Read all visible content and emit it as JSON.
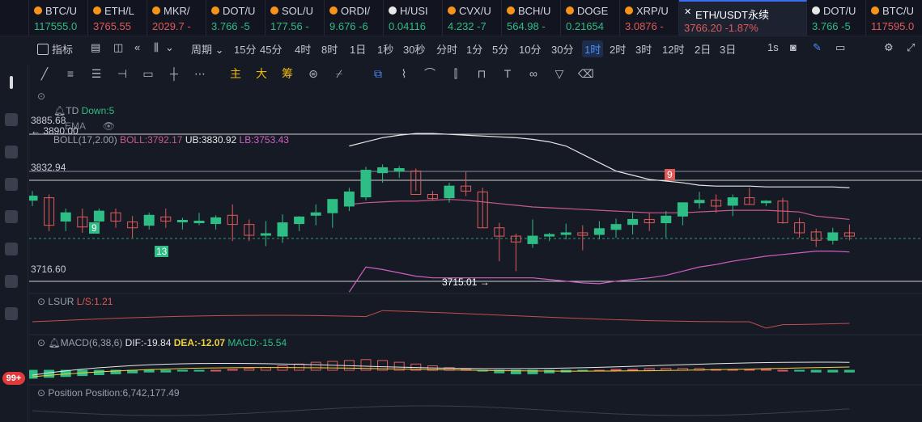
{
  "tickers": [
    {
      "name": "BTC/U",
      "price": "117555.0",
      "up": true,
      "icon": "btc-icon",
      "iconColor": "#f7931a"
    },
    {
      "name": "ETH/L",
      "price": "3765.55",
      "up": false,
      "icon": "eth-icon",
      "iconColor": "#f7931a"
    },
    {
      "name": "MKR/",
      "price": "2029.7 -",
      "up": false,
      "icon": "mkr-icon",
      "iconColor": "#f7931a"
    },
    {
      "name": "DOT/U",
      "price": "3.766 -5",
      "up": true,
      "icon": "dot-icon",
      "iconColor": "#f7931a"
    },
    {
      "name": "SOL/U",
      "price": "177.56 -",
      "up": true,
      "icon": "sol-icon",
      "iconColor": "#f7931a"
    },
    {
      "name": "ORDI/",
      "price": "9.676 -6",
      "up": true,
      "icon": "ordi-icon",
      "iconColor": "#f7931a"
    },
    {
      "name": "H/USI",
      "price": "0.04116",
      "up": true,
      "icon": "h-icon",
      "iconColor": "#e8e8e8"
    },
    {
      "name": "CVX/U",
      "price": "4.232 -7",
      "up": true,
      "icon": "cvx-icon",
      "iconColor": "#f7931a"
    },
    {
      "name": "BCH/U",
      "price": "564.98 -",
      "up": true,
      "icon": "bch-icon",
      "iconColor": "#f7931a"
    },
    {
      "name": "DOGE",
      "price": "0.21654",
      "up": true,
      "icon": "doge-icon",
      "iconColor": "#f7931a"
    },
    {
      "name": "XRP/U",
      "price": "3.0876 -",
      "up": false,
      "icon": "xrp-icon",
      "iconColor": "#f7931a"
    },
    {
      "name": "ETH/USDT永续",
      "price": "3766.20  -1.87%",
      "up": false,
      "active": true,
      "icon": "close-icon",
      "iconColor": "#ffffff"
    },
    {
      "name": "DOT/U",
      "price": "3.766 -5",
      "up": true,
      "icon": "dot-icon",
      "iconColor": "#e8e8e8"
    },
    {
      "name": "BTC/U",
      "price": "117595.0",
      "up": false,
      "icon": "btc-icon",
      "iconColor": "#f7931a"
    }
  ],
  "toolbar": {
    "indicator_label": "指标",
    "period_label": "周期",
    "intervals": [
      "15分",
      "45分",
      "4时",
      "8时",
      "1日",
      "1秒",
      "30秒",
      "分时",
      "1分",
      "5分",
      "10分",
      "30分",
      "1时",
      "2时",
      "3时",
      "12时",
      "2日",
      "3日"
    ],
    "active_interval": "1时",
    "right_label": "1s"
  },
  "drawtools": {
    "labels": [
      "主",
      "大",
      "筹"
    ]
  },
  "indicators": {
    "td": "TD",
    "td_value": "Down:5",
    "ema": "EMA",
    "boll": "BOLL(17,2.00)",
    "boll_mid": "BOLL:3792.17",
    "boll_ub": "UB:3830.92",
    "boll_lb": "LB:3753.43",
    "lsur": "LSUR",
    "lsur_value": "L/S:1.21",
    "macd": "MACD(6,38,6)",
    "macd_dif": "DIF:-19.84",
    "macd_dea": "DEA:-12.07",
    "macd_val": "MACD:-15.54",
    "position": "Position",
    "position_value": "Position:6,742,177.49"
  },
  "price_labels": {
    "top_price": "3885.68",
    "arrow_price": "← 3890.00",
    "level_2": "3832.94",
    "low_left": "3716.60",
    "low_mark": "3715.01 →"
  },
  "td_marks": [
    "9",
    "13",
    "9"
  ],
  "badge": "99+",
  "colors": {
    "up": "#2ebd85",
    "down": "#e05a5a",
    "boll_mid": "#c85a8a",
    "boll_band": "#d060c0",
    "accent": "#4a8ff7",
    "yellow": "#f0d040"
  },
  "chart_data": {
    "type": "candlestick",
    "ohlc": [
      [
        3815,
        3826,
        3808,
        3820
      ],
      [
        3818,
        3822,
        3778,
        3785
      ],
      [
        3790,
        3805,
        3778,
        3800
      ],
      [
        3795,
        3805,
        3776,
        3783
      ],
      [
        3790,
        3805,
        3783,
        3802
      ],
      [
        3800,
        3805,
        3782,
        3790
      ],
      [
        3789,
        3796,
        3770,
        3782
      ],
      [
        3785,
        3800,
        3780,
        3797
      ],
      [
        3795,
        3805,
        3782,
        3790
      ],
      [
        3789,
        3794,
        3780,
        3791
      ],
      [
        3788,
        3800,
        3785,
        3790
      ],
      [
        3787,
        3797,
        3780,
        3794
      ],
      [
        3797,
        3810,
        3766,
        3786
      ],
      [
        3786,
        3792,
        3766,
        3773
      ],
      [
        3773,
        3790,
        3760,
        3775
      ],
      [
        3772,
        3798,
        3764,
        3788
      ],
      [
        3787,
        3796,
        3778,
        3795
      ],
      [
        3797,
        3810,
        3785,
        3800
      ],
      [
        3800,
        3814,
        3782,
        3816
      ],
      [
        3808,
        3830,
        3802,
        3825
      ],
      [
        3819,
        3855,
        3815,
        3851
      ],
      [
        3848,
        3858,
        3836,
        3854
      ],
      [
        3850,
        3856,
        3842,
        3853
      ],
      [
        3850,
        3853,
        3826,
        3822
      ],
      [
        3822,
        3826,
        3815,
        3817
      ],
      [
        3818,
        3836,
        3812,
        3832
      ],
      [
        3832,
        3849,
        3820,
        3826
      ],
      [
        3825,
        3830,
        3782,
        3782
      ],
      [
        3782,
        3788,
        3742,
        3772
      ],
      [
        3772,
        3775,
        3730,
        3765
      ],
      [
        3763,
        3792,
        3758,
        3772
      ],
      [
        3772,
        3776,
        3766,
        3774
      ],
      [
        3774,
        3787,
        3768,
        3776
      ],
      [
        3776,
        3785,
        3755,
        3773
      ],
      [
        3774,
        3790,
        3768,
        3781
      ],
      [
        3780,
        3793,
        3770,
        3786
      ],
      [
        3786,
        3800,
        3774,
        3792
      ],
      [
        3792,
        3800,
        3778,
        3788
      ],
      [
        3788,
        3802,
        3770,
        3796
      ],
      [
        3796,
        3812,
        3785,
        3812
      ],
      [
        3812,
        3825,
        3805,
        3815
      ],
      [
        3815,
        3822,
        3800,
        3808
      ],
      [
        3809,
        3822,
        3796,
        3818
      ],
      [
        3818,
        3830,
        3810,
        3810
      ],
      [
        3812,
        3815,
        3808,
        3814
      ],
      [
        3814,
        3818,
        3787,
        3788
      ],
      [
        3788,
        3794,
        3770,
        3776
      ],
      [
        3777,
        3781,
        3759,
        3767
      ],
      [
        3767,
        3782,
        3762,
        3776
      ],
      [
        3776,
        3786,
        3767,
        3772
      ]
    ],
    "boll_mid": [
      3792,
      3793,
      3794,
      3795,
      3796,
      3796,
      3797,
      3797,
      3797,
      3798,
      3799,
      3800,
      3801,
      3802,
      3802,
      3802,
      3803,
      3805,
      3808,
      3810,
      3812,
      3813,
      3814,
      3814,
      3815,
      3816,
      3815,
      3813,
      3811,
      3809,
      3807,
      3806,
      3805,
      3804,
      3803,
      3802,
      3801,
      3800,
      3800,
      3800,
      3801,
      3802,
      3803,
      3803,
      3803,
      3802,
      3801,
      3796,
      3794,
      3792
    ],
    "boll_ub": [
      3865,
      3866,
      3868,
      3870,
      3872,
      3874,
      3876,
      3878,
      3880,
      3881,
      3880,
      3878,
      3876,
      3874,
      3872,
      3871,
      3872,
      3874,
      3876,
      3880,
      3885,
      3890,
      3893,
      3895,
      3895,
      3894,
      3893,
      3892,
      3891,
      3890,
      3888,
      3885,
      3880,
      3870,
      3860,
      3850,
      3845,
      3840,
      3838,
      3836,
      3833,
      3832,
      3832,
      3832,
      3831,
      3831,
      3831,
      3831,
      3831,
      3830
    ],
    "boll_lb": [
      3720,
      3720,
      3720,
      3720,
      3720,
      3720,
      3720,
      3720,
      3720,
      3720,
      3720,
      3720,
      3720,
      3720,
      3720,
      3720,
      3718,
      3715,
      3710,
      3705,
      3735,
      3732,
      3728,
      3724,
      3722,
      3722,
      3722,
      3722,
      3722,
      3722,
      3722,
      3720,
      3718,
      3716,
      3715,
      3718,
      3720,
      3722,
      3725,
      3730,
      3735,
      3738,
      3742,
      3745,
      3748,
      3750,
      3752,
      3754,
      3754,
      3753
    ],
    "visible_from": 19,
    "ub_visible_from": 19,
    "macd_hist": [
      -9,
      -8,
      -7,
      -6,
      -5,
      -4,
      -3,
      -2,
      -2,
      -1,
      -1,
      0,
      1,
      2,
      3,
      5,
      7,
      9,
      10,
      11,
      12,
      11,
      9,
      7,
      5,
      3,
      1,
      -1,
      -3,
      -4,
      -4,
      -3,
      -2,
      -1,
      0,
      1,
      1,
      2,
      2,
      2,
      2,
      1,
      1,
      1,
      1,
      0,
      -1,
      -2,
      -2,
      -2
    ],
    "yrange": [
      3712,
      3900
    ]
  }
}
